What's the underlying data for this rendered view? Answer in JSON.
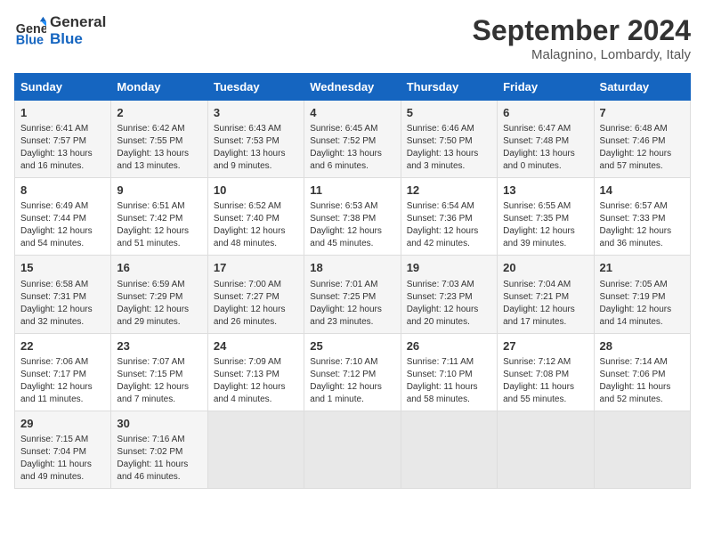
{
  "logo": {
    "line1": "General",
    "line2": "Blue"
  },
  "title": "September 2024",
  "location": "Malagnino, Lombardy, Italy",
  "headers": [
    "Sunday",
    "Monday",
    "Tuesday",
    "Wednesday",
    "Thursday",
    "Friday",
    "Saturday"
  ],
  "weeks": [
    [
      {
        "day": "1",
        "info": "Sunrise: 6:41 AM\nSunset: 7:57 PM\nDaylight: 13 hours\nand 16 minutes."
      },
      {
        "day": "2",
        "info": "Sunrise: 6:42 AM\nSunset: 7:55 PM\nDaylight: 13 hours\nand 13 minutes."
      },
      {
        "day": "3",
        "info": "Sunrise: 6:43 AM\nSunset: 7:53 PM\nDaylight: 13 hours\nand 9 minutes."
      },
      {
        "day": "4",
        "info": "Sunrise: 6:45 AM\nSunset: 7:52 PM\nDaylight: 13 hours\nand 6 minutes."
      },
      {
        "day": "5",
        "info": "Sunrise: 6:46 AM\nSunset: 7:50 PM\nDaylight: 13 hours\nand 3 minutes."
      },
      {
        "day": "6",
        "info": "Sunrise: 6:47 AM\nSunset: 7:48 PM\nDaylight: 13 hours\nand 0 minutes."
      },
      {
        "day": "7",
        "info": "Sunrise: 6:48 AM\nSunset: 7:46 PM\nDaylight: 12 hours\nand 57 minutes."
      }
    ],
    [
      {
        "day": "8",
        "info": "Sunrise: 6:49 AM\nSunset: 7:44 PM\nDaylight: 12 hours\nand 54 minutes."
      },
      {
        "day": "9",
        "info": "Sunrise: 6:51 AM\nSunset: 7:42 PM\nDaylight: 12 hours\nand 51 minutes."
      },
      {
        "day": "10",
        "info": "Sunrise: 6:52 AM\nSunset: 7:40 PM\nDaylight: 12 hours\nand 48 minutes."
      },
      {
        "day": "11",
        "info": "Sunrise: 6:53 AM\nSunset: 7:38 PM\nDaylight: 12 hours\nand 45 minutes."
      },
      {
        "day": "12",
        "info": "Sunrise: 6:54 AM\nSunset: 7:36 PM\nDaylight: 12 hours\nand 42 minutes."
      },
      {
        "day": "13",
        "info": "Sunrise: 6:55 AM\nSunset: 7:35 PM\nDaylight: 12 hours\nand 39 minutes."
      },
      {
        "day": "14",
        "info": "Sunrise: 6:57 AM\nSunset: 7:33 PM\nDaylight: 12 hours\nand 36 minutes."
      }
    ],
    [
      {
        "day": "15",
        "info": "Sunrise: 6:58 AM\nSunset: 7:31 PM\nDaylight: 12 hours\nand 32 minutes."
      },
      {
        "day": "16",
        "info": "Sunrise: 6:59 AM\nSunset: 7:29 PM\nDaylight: 12 hours\nand 29 minutes."
      },
      {
        "day": "17",
        "info": "Sunrise: 7:00 AM\nSunset: 7:27 PM\nDaylight: 12 hours\nand 26 minutes."
      },
      {
        "day": "18",
        "info": "Sunrise: 7:01 AM\nSunset: 7:25 PM\nDaylight: 12 hours\nand 23 minutes."
      },
      {
        "day": "19",
        "info": "Sunrise: 7:03 AM\nSunset: 7:23 PM\nDaylight: 12 hours\nand 20 minutes."
      },
      {
        "day": "20",
        "info": "Sunrise: 7:04 AM\nSunset: 7:21 PM\nDaylight: 12 hours\nand 17 minutes."
      },
      {
        "day": "21",
        "info": "Sunrise: 7:05 AM\nSunset: 7:19 PM\nDaylight: 12 hours\nand 14 minutes."
      }
    ],
    [
      {
        "day": "22",
        "info": "Sunrise: 7:06 AM\nSunset: 7:17 PM\nDaylight: 12 hours\nand 11 minutes."
      },
      {
        "day": "23",
        "info": "Sunrise: 7:07 AM\nSunset: 7:15 PM\nDaylight: 12 hours\nand 7 minutes."
      },
      {
        "day": "24",
        "info": "Sunrise: 7:09 AM\nSunset: 7:13 PM\nDaylight: 12 hours\nand 4 minutes."
      },
      {
        "day": "25",
        "info": "Sunrise: 7:10 AM\nSunset: 7:12 PM\nDaylight: 12 hours\nand 1 minute."
      },
      {
        "day": "26",
        "info": "Sunrise: 7:11 AM\nSunset: 7:10 PM\nDaylight: 11 hours\nand 58 minutes."
      },
      {
        "day": "27",
        "info": "Sunrise: 7:12 AM\nSunset: 7:08 PM\nDaylight: 11 hours\nand 55 minutes."
      },
      {
        "day": "28",
        "info": "Sunrise: 7:14 AM\nSunset: 7:06 PM\nDaylight: 11 hours\nand 52 minutes."
      }
    ],
    [
      {
        "day": "29",
        "info": "Sunrise: 7:15 AM\nSunset: 7:04 PM\nDaylight: 11 hours\nand 49 minutes."
      },
      {
        "day": "30",
        "info": "Sunrise: 7:16 AM\nSunset: 7:02 PM\nDaylight: 11 hours\nand 46 minutes."
      },
      null,
      null,
      null,
      null,
      null
    ]
  ]
}
